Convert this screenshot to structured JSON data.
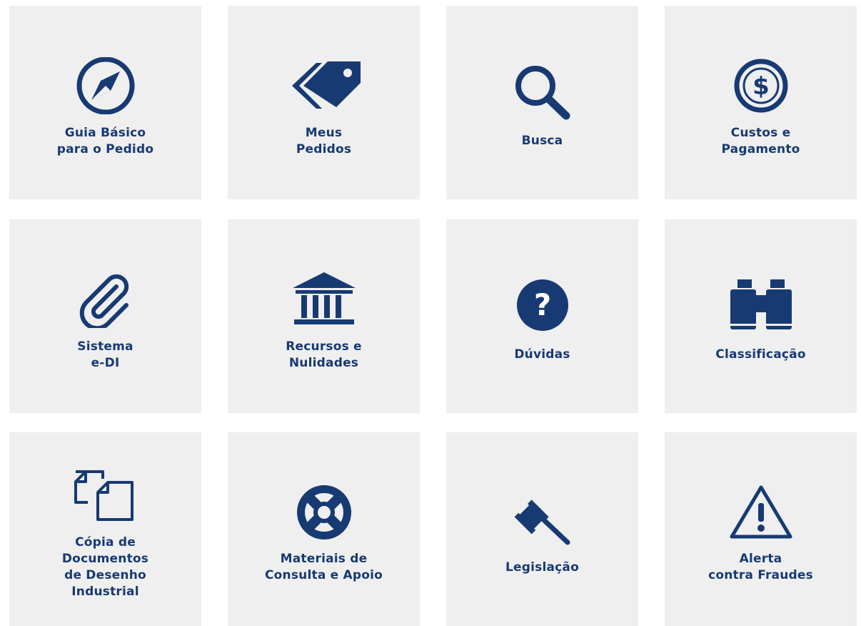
{
  "colors": {
    "tile_background": "#efefef",
    "page_background": "#ffffff",
    "accent": "#173a73"
  },
  "tiles": [
    {
      "icon": "compass-icon",
      "label_lines": [
        "Guia Básico",
        "para o Pedido"
      ]
    },
    {
      "icon": "tags-icon",
      "label_lines": [
        "Meus",
        "Pedidos"
      ]
    },
    {
      "icon": "search-icon",
      "label_lines": [
        "Busca"
      ]
    },
    {
      "icon": "dollar-circle-icon",
      "label_lines": [
        "Custos e",
        "Pagamento"
      ]
    },
    {
      "icon": "paperclip-icon",
      "label_lines": [
        "Sistema",
        "e-DI"
      ]
    },
    {
      "icon": "institution-icon",
      "label_lines": [
        "Recursos e",
        "Nulidades"
      ]
    },
    {
      "icon": "question-circle-icon",
      "label_lines": [
        "Dúvidas"
      ]
    },
    {
      "icon": "binoculars-icon",
      "label_lines": [
        "Classificação"
      ]
    },
    {
      "icon": "documents-copy-icon",
      "label_lines": [
        "Cópia de",
        "Documentos",
        "de Desenho",
        "Industrial"
      ]
    },
    {
      "icon": "life-ring-icon",
      "label_lines": [
        "Materiais de",
        "Consulta e Apoio"
      ]
    },
    {
      "icon": "gavel-icon",
      "label_lines": [
        "Legislação"
      ]
    },
    {
      "icon": "warning-triangle-icon",
      "label_lines": [
        "Alerta",
        "contra Fraudes"
      ]
    }
  ]
}
